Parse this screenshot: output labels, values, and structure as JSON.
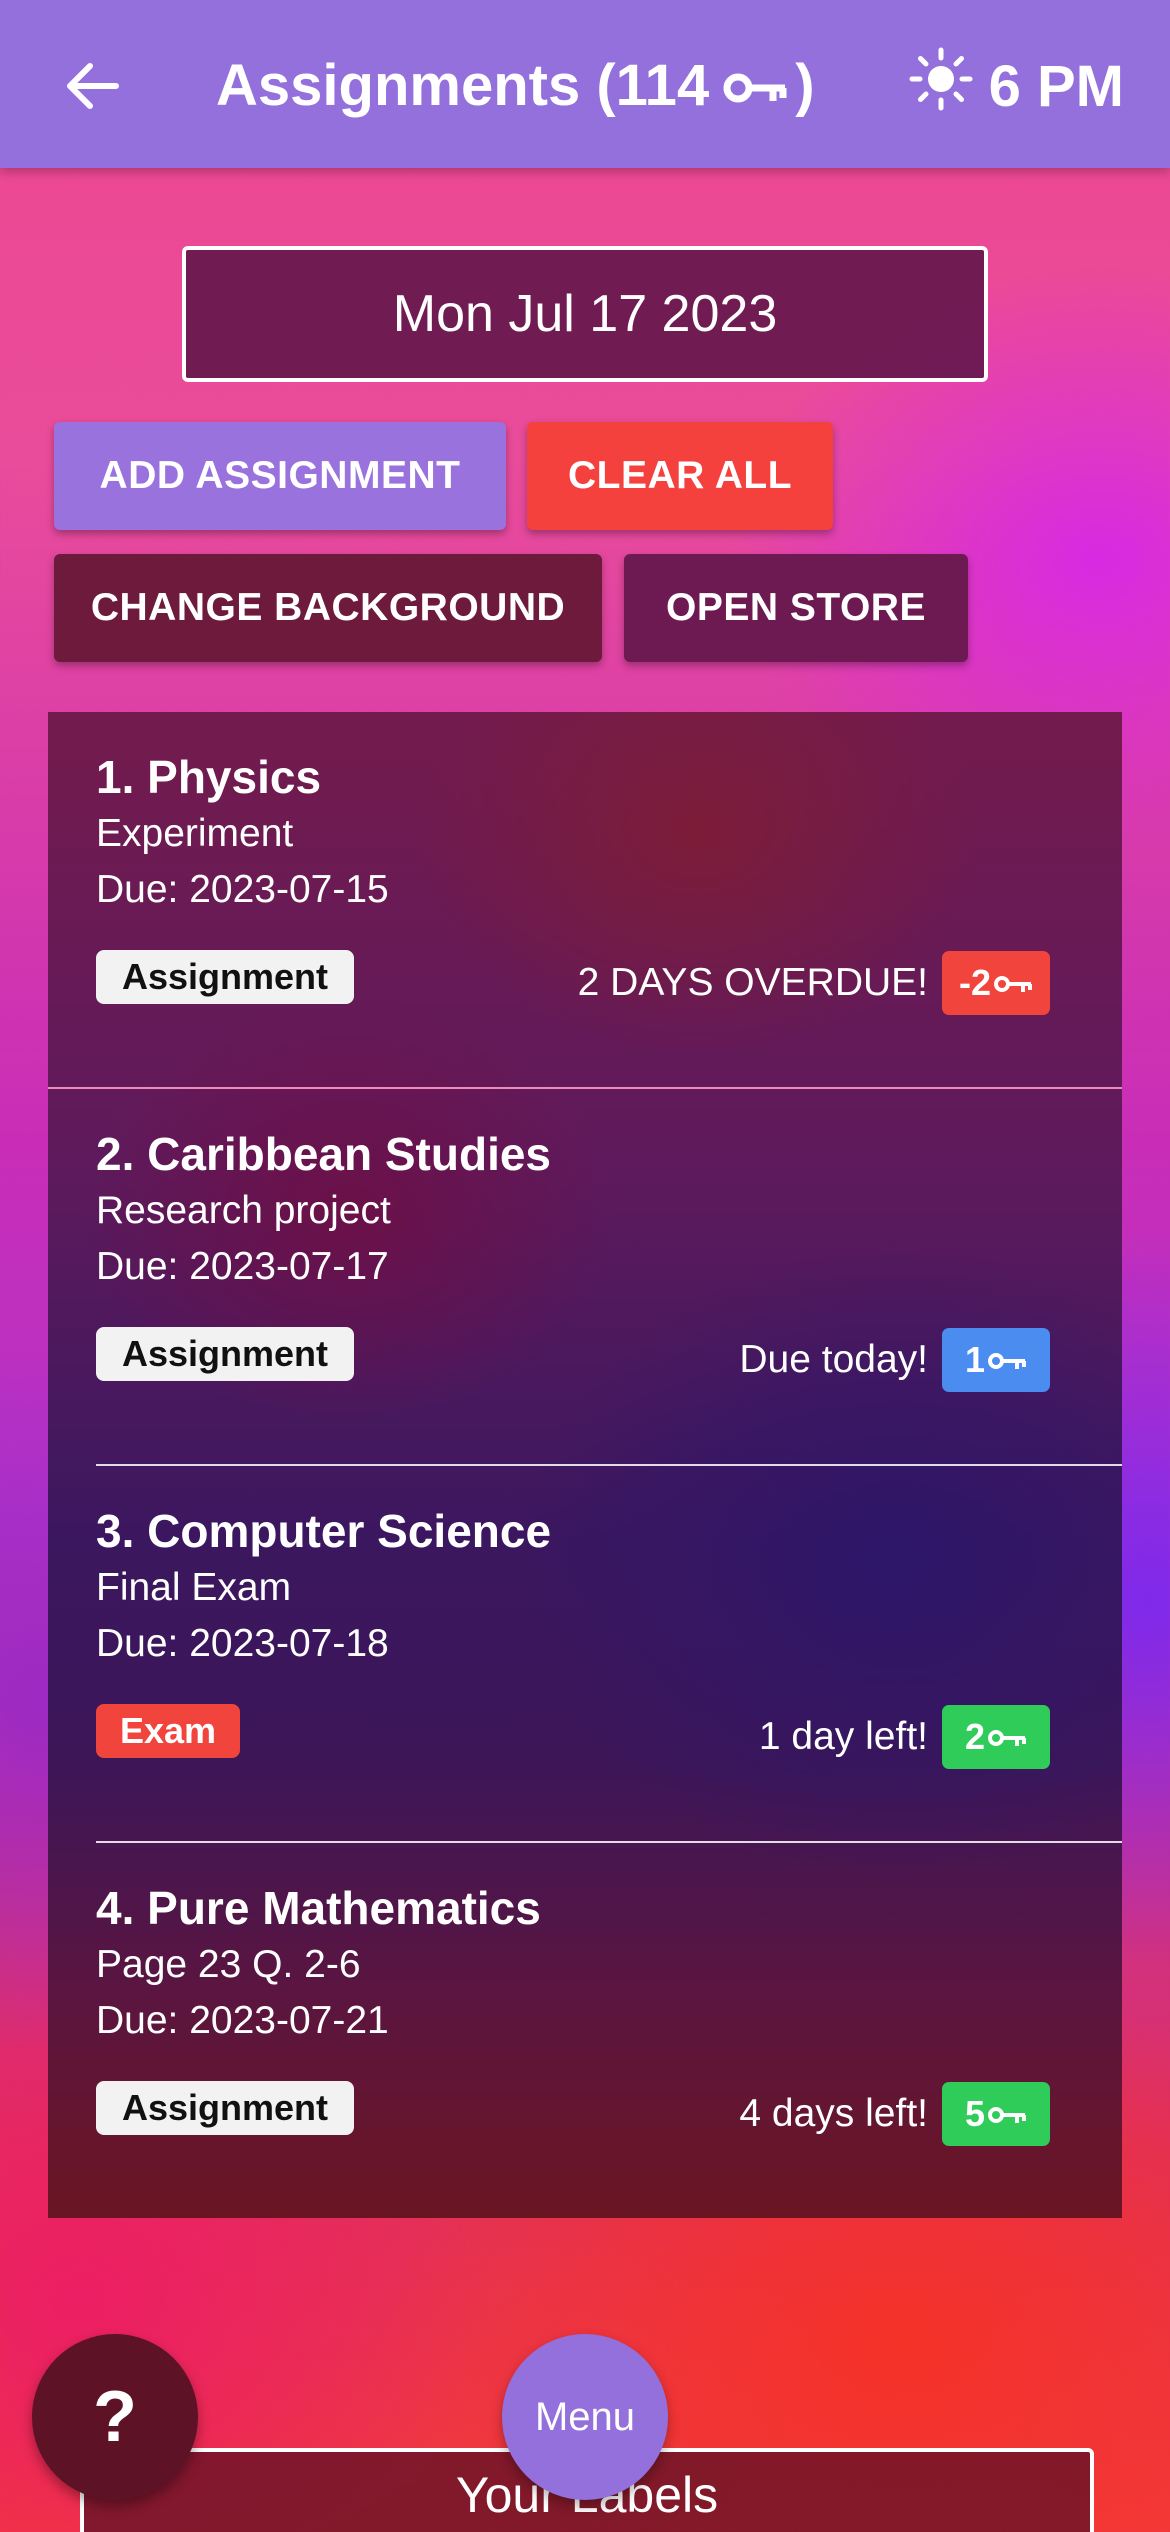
{
  "app_bar": {
    "title": "Assignments (114",
    "title_suffix": ")",
    "time": "6 PM",
    "icons": [
      "back-arrow-icon",
      "key-icon",
      "sun-icon"
    ]
  },
  "date": "Mon Jul 17 2023",
  "buttons": {
    "add": "ADD ASSIGNMENT",
    "clear": "CLEAR ALL",
    "change_background": "CHANGE BACKGROUND",
    "open_store": "OPEN STORE"
  },
  "colors": {
    "app_bar": "#9470dc",
    "clear_button": "#f4413d",
    "overdue_badge": "#f0443c",
    "today_badge": "#4a8cf0",
    "future_badge": "#2fcc5a",
    "menu_button": "#9370db"
  },
  "assignments": [
    {
      "title": "1. Physics",
      "description": "Experiment",
      "due": "Due: 2023-07-15",
      "tag": "Assignment",
      "status": "2 DAYS OVERDUE!",
      "keys": "-2"
    },
    {
      "title": "2. Caribbean Studies",
      "description": "Research project",
      "due": "Due: 2023-07-17",
      "tag": "Assignment",
      "status": "Due today!",
      "keys": "1"
    },
    {
      "title": "3. Computer Science",
      "description": "Final Exam",
      "due": "Due: 2023-07-18",
      "tag": "Exam",
      "status": "1 day left!",
      "keys": "2"
    },
    {
      "title": "4. Pure Mathematics",
      "description": "Page 23 Q. 2-6",
      "due": "Due: 2023-07-21",
      "tag": "Assignment",
      "status": "4 days left!",
      "keys": "5"
    }
  ],
  "bottom": {
    "help": "?",
    "menu": "Menu",
    "labels_title": "Your Labels"
  }
}
